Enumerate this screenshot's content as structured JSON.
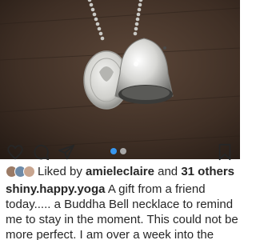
{
  "post": {
    "photo_alt": "Buddha Bell necklace photo",
    "icons": {
      "like": "heart-icon",
      "comment": "comment-icon",
      "share": "send-icon",
      "save": "bookmark-icon"
    },
    "carousel_dots_active": true
  },
  "likes": {
    "prefix": "Liked by",
    "first_user": "amieleclaire",
    "joiner": "and",
    "others": "31 others"
  },
  "caption": {
    "username": "shiny.happy.yoga",
    "text": "A gift from a friend today..... a Buddha Bell necklace to remind me to stay in the moment. This could not be more perfect. I am over a week into the"
  },
  "colors": {
    "accent_blue": "#3897f0",
    "text": "#262626",
    "dot_inactive": "#a8a8a8"
  }
}
